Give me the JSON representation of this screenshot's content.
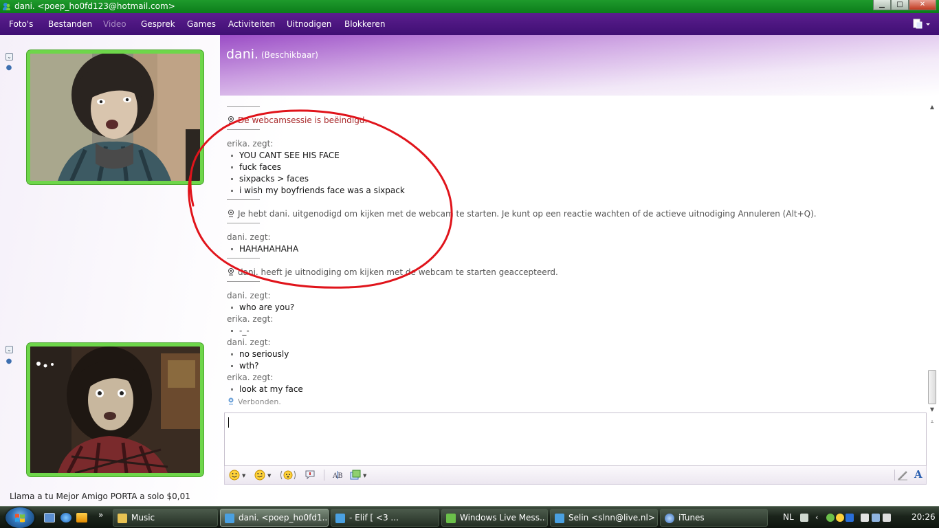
{
  "window": {
    "title": "dani. <poep_ho0fd123@hotmail.com>",
    "buttons": {
      "minimize": "▁",
      "maximize": "□",
      "close": "✕"
    }
  },
  "menu": {
    "items": [
      "Foto's",
      "Bestanden",
      "Video",
      "Gesprek",
      "Games",
      "Activiteiten",
      "Uitnodigen",
      "Blokkeren"
    ],
    "disabled": "Video",
    "right_icon": "sharing-menu-icon"
  },
  "contact": {
    "name": "dani.",
    "status": "(Beschikbaar)"
  },
  "conversation": {
    "session_ended": "De webcamsessie is beëindigd.",
    "block1_sender": "erika. zegt:",
    "block1_messages": [
      "YOU CANT SEE HIS FACE",
      "fuck faces",
      "sixpacks > faces",
      "i wish my boyfriends face was a sixpack"
    ],
    "invite_notice": "Je hebt dani. uitgenodigd om kijken met de webcam te starten. Je kunt op een reactie wachten of de actieve uitnodiging Annuleren (Alt+Q).",
    "block2_sender": "dani. zegt:",
    "block2_messages": [
      "HAHAHAHAHA"
    ],
    "accepted_notice": "dani. heeft je uitnodiging om kijken met de webcam te starten geaccepteerd.",
    "block3_sender": "dani. zegt:",
    "block3_messages": [
      "who are you?"
    ],
    "block4_sender": "erika. zegt:",
    "block4_messages": [
      "-_-"
    ],
    "block5_sender": "dani. zegt:",
    "block5_messages": [
      "no seriously",
      "wth?"
    ],
    "block6_sender": "erika. zegt:",
    "block6_messages": [
      "look at my face"
    ],
    "connected": "Verbonden."
  },
  "input": {
    "value": ""
  },
  "toolbar": {
    "icons": [
      "emoticon-icon",
      "wink-icon",
      "nudge-icon",
      "voice-clip-icon",
      "font-icon",
      "background-icon",
      "pencil-icon",
      "font-style-icon"
    ],
    "font_label": "A"
  },
  "ad": {
    "text": "Llama a tu Mejor Amigo PORTA a solo $0,01"
  },
  "taskbar": {
    "tasks": [
      "Music",
      "dani. <poep_ho0fd1...",
      "-    Elif         [ <3 ...",
      "Windows Live Mess...",
      "Selin <slnn@live.nl>",
      "iTunes"
    ],
    "active_task": "dani. <poep_ho0fd1...",
    "language": "NL",
    "clock": "20:26",
    "more_arrow": "»"
  },
  "colors": {
    "menu_purple": "#4a1580",
    "title_green": "#0f8a20",
    "frame_green": "#6ed64a",
    "annotation_red": "#e0141b"
  }
}
